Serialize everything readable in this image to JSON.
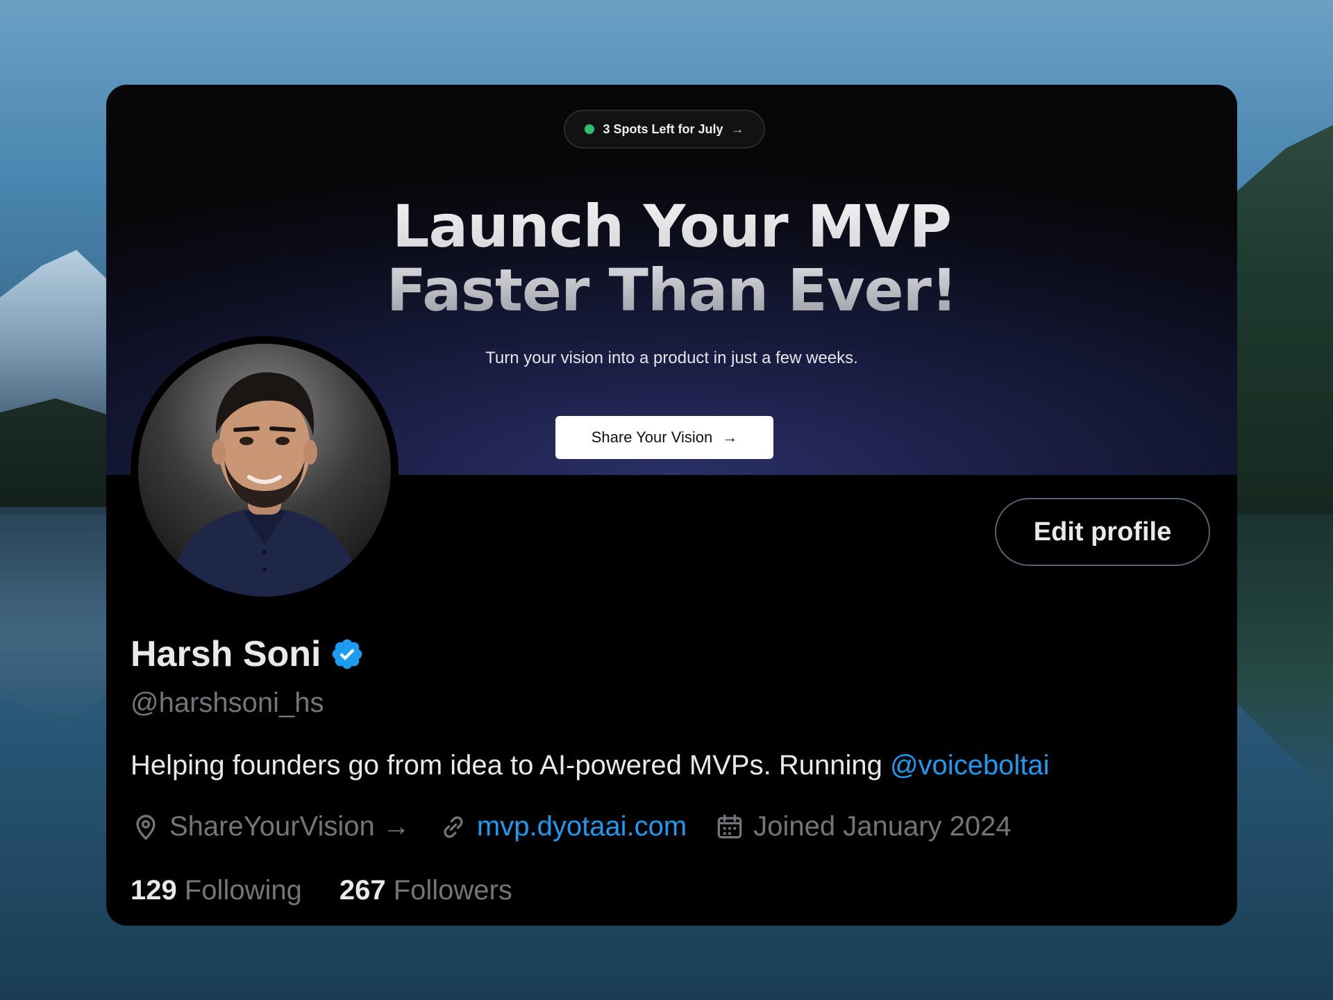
{
  "banner": {
    "pill_text": "3 Spots Left for July",
    "pill_arrow": "→",
    "headline_line1": "Launch Your MVP",
    "headline_line2": "Faster Than Ever!",
    "subline": "Turn your vision into a product in just a few weeks.",
    "cta_label": "Share Your Vision",
    "cta_arrow": "→"
  },
  "profile": {
    "name": "Harsh Soni",
    "handle": "@harshsoni_hs",
    "edit_button": "Edit profile",
    "bio_text": "Helping founders go from idea to AI-powered MVPs. Running ",
    "bio_mention": "@voiceboltai",
    "location": "ShareYourVision →",
    "website": "mvp.dyotaai.com",
    "joined": "Joined January 2024",
    "following_count": "129",
    "following_label": "Following",
    "followers_count": "267",
    "followers_label": "Followers"
  },
  "icons": {
    "verified": "verified-badge-icon",
    "location": "location-pin-icon",
    "link": "link-icon",
    "calendar": "calendar-icon"
  },
  "colors": {
    "accent": "#1d9bf0",
    "text_primary": "#e7e9ea",
    "text_secondary": "#71767b",
    "card_background": "#000000",
    "status_dot": "#2fbf71"
  }
}
